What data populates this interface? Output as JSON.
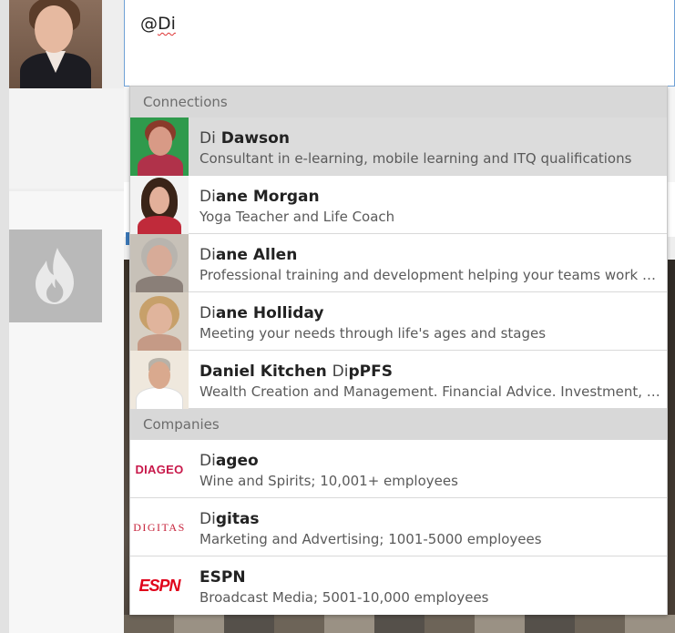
{
  "compose": {
    "at_sign": "@",
    "typed_query": "Di"
  },
  "typeahead": {
    "connections_header": "Connections",
    "companies_header": "Companies",
    "connections": [
      {
        "match": "Di",
        "rest": " Dawson",
        "subtitle": "Consultant in e-learning, mobile learning and ITQ qualifications",
        "selected": true
      },
      {
        "match": "Di",
        "rest": "ane Morgan",
        "subtitle": "Yoga Teacher and Life Coach",
        "selected": false
      },
      {
        "match": "Di",
        "rest": "ane Allen",
        "subtitle": "Professional training and development helping your teams work e...",
        "selected": false
      },
      {
        "match": "Di",
        "rest": "ane Holliday",
        "subtitle": "Meeting your needs through life's ages and stages",
        "selected": false
      },
      {
        "prefix": "Daniel Kitchen ",
        "match": "Di",
        "rest": "pPFS",
        "subtitle": "Wealth Creation and Management. Financial Advice. Investment, P...",
        "selected": false
      }
    ],
    "companies": [
      {
        "match": "Di",
        "rest": "ageo",
        "subtitle": "Wine and Spirits; 10,001+ employees",
        "logo_text": "DIAGEO"
      },
      {
        "match": "Di",
        "rest": "gitas",
        "subtitle": "Marketing and Advertising; 1001-5000 employees",
        "logo_text": "DIGITAS"
      },
      {
        "match": "",
        "rest": "ESPN",
        "subtitle": "Broadcast Media; 5001-10,000 employees",
        "logo_text": "ESPN"
      }
    ]
  },
  "colors": {
    "focus_border": "#6fa1d6",
    "section_header_bg": "#d8d8d8",
    "selected_row_bg": "#dcdcdc",
    "diageo_red": "#c8184a",
    "espn_red": "#e0001a"
  }
}
